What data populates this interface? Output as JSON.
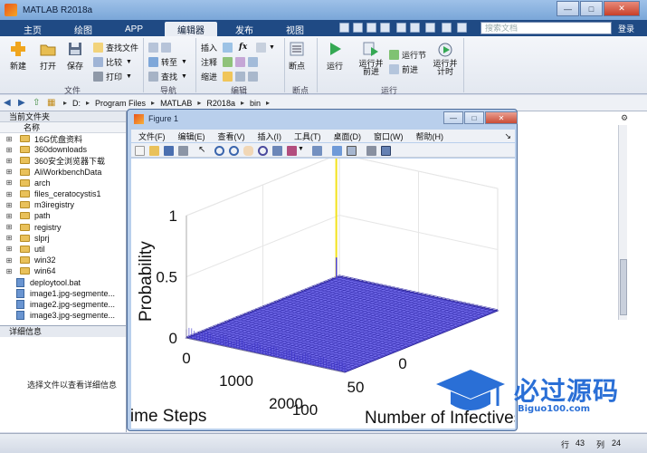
{
  "window": {
    "title": "MATLAB R2018a"
  },
  "tabs": [
    {
      "label": "主页"
    },
    {
      "label": "绘图"
    },
    {
      "label": "APP"
    },
    {
      "label": "编辑器"
    },
    {
      "label": "发布"
    },
    {
      "label": "视图"
    }
  ],
  "search": {
    "placeholder": "搜索文档"
  },
  "login": "登录",
  "ribbon": {
    "file_group": {
      "label": "文件",
      "new": "新建",
      "open": "打开",
      "save": "保存",
      "find_files": "查找文件",
      "compare": "比较",
      "print": "打印"
    },
    "navigate_group": {
      "label": "导航",
      "goto": "转至",
      "find": "查找"
    },
    "edit_group": {
      "label": "编辑",
      "insert": "插入",
      "comment": "注释",
      "indent": "缩进",
      "fx": "fx"
    },
    "breakpoints_group": {
      "label": "断点",
      "breakpoints": "断点"
    },
    "run_group": {
      "label": "运行",
      "run": "运行",
      "run_advance": "运行并前进",
      "run_section": "运行节",
      "advance": "前进",
      "run_time": "运行并计时"
    }
  },
  "address": [
    "D:",
    "Program Files",
    "MATLAB",
    "R2018a",
    "bin"
  ],
  "current_folder": {
    "title": "当前文件夹",
    "column": "名称",
    "folders": [
      "16G优盘资料",
      "360downloads",
      "360安全浏览器下载",
      "AliWorkbenchData",
      "arch",
      "files_ceratocystis1",
      "m3iregistry",
      "path",
      "registry",
      "slprj",
      "util",
      "win32",
      "win64"
    ],
    "files": [
      "deploytool.bat",
      "image1.jpg-segmente...",
      "image2.jpg-segmente...",
      "image3.jpg-segmente..."
    ]
  },
  "details": {
    "title": "详细信息",
    "message": "选择文件以查看详细信息"
  },
  "status": {
    "row_label": "行",
    "row_value": "43",
    "col_label": "列",
    "col_value": "24"
  },
  "figure": {
    "title": "Figure 1",
    "menu": [
      "文件(F)",
      "编辑(E)",
      "查看(V)",
      "插入(I)",
      "工具(T)",
      "桌面(D)",
      "窗口(W)",
      "帮助(H)"
    ]
  },
  "chart_data": {
    "type": "surface",
    "zlabel": "Probability",
    "xlabel": "Number of Infectives",
    "ylabel": "Time Steps",
    "zticks": [
      "0",
      "0.5",
      "1"
    ],
    "xticks": [
      "0",
      "50",
      "100"
    ],
    "yticks": [
      "0",
      "1000",
      "2000"
    ],
    "xlim": [
      0,
      100
    ],
    "ylim": [
      0,
      2000
    ],
    "zlim": [
      0,
      1
    ],
    "peak": {
      "x": 0,
      "y": 0,
      "z": 1
    },
    "surface_color": "#5a4fe0",
    "peak_color": "#f2e21b"
  },
  "watermark": {
    "text": "必过源码",
    "sub": "Biguo100.com"
  }
}
